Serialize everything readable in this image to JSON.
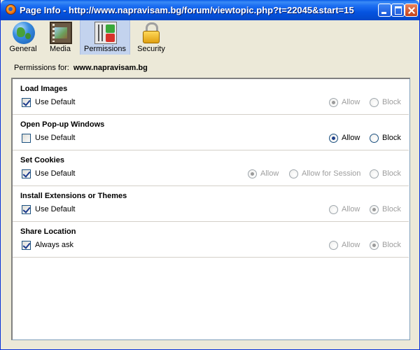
{
  "window": {
    "title": "Page Info - http://www.napravisam.bg/forum/viewtopic.php?t=22045&start=15"
  },
  "tabs": [
    {
      "label": "General",
      "icon": "globe-icon",
      "selected": false
    },
    {
      "label": "Media",
      "icon": "media-icon",
      "selected": false
    },
    {
      "label": "Permissions",
      "icon": "permissions-icon",
      "selected": true
    },
    {
      "label": "Security",
      "icon": "lock-icon",
      "selected": false
    }
  ],
  "permissions_for": {
    "label": "Permissions for:",
    "site": "www.napravisam.bg"
  },
  "permissions": [
    {
      "title": "Load Images",
      "checkbox_label": "Use Default",
      "checked": true,
      "options": [
        "Allow",
        "Block"
      ],
      "selected": "Allow",
      "enabled": false
    },
    {
      "title": "Open Pop-up Windows",
      "checkbox_label": "Use Default",
      "checked": false,
      "options": [
        "Allow",
        "Block"
      ],
      "selected": "Allow",
      "enabled": true
    },
    {
      "title": "Set Cookies",
      "checkbox_label": "Use Default",
      "checked": true,
      "options": [
        "Allow",
        "Allow for Session",
        "Block"
      ],
      "selected": "Allow",
      "enabled": false
    },
    {
      "title": "Install Extensions or Themes",
      "checkbox_label": "Use Default",
      "checked": true,
      "options": [
        "Allow",
        "Block"
      ],
      "selected": "Block",
      "enabled": false
    },
    {
      "title": "Share Location",
      "checkbox_label": "Always ask",
      "checked": true,
      "options": [
        "Allow",
        "Block"
      ],
      "selected": "Block",
      "enabled": false
    }
  ],
  "colors": {
    "titlebar": "#0553e0",
    "selected_tab": "#c3d3ee",
    "window_bg": "#ece9d8"
  }
}
